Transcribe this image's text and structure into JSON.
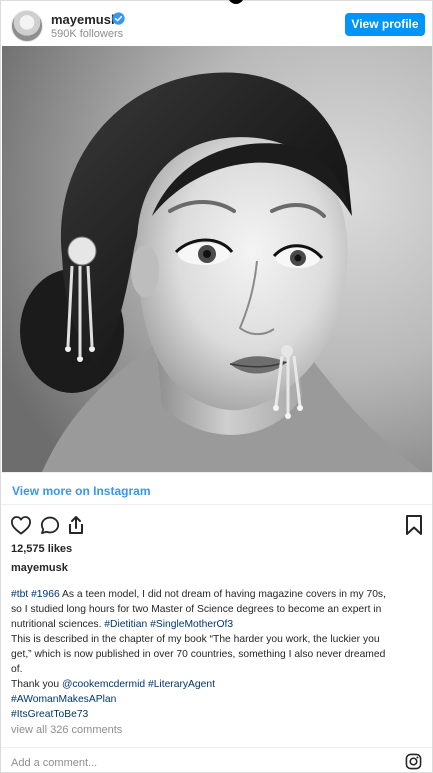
{
  "header": {
    "username": "mayemusk",
    "followers": "590K followers",
    "view_profile_label": "View profile"
  },
  "view_more_label": "View more on Instagram",
  "likes": "12,575 likes",
  "caption": {
    "username": "mayemusk",
    "lines": [
      {
        "parts": [
          {
            "t": "#tbt",
            "tag": true
          },
          {
            "t": " "
          },
          {
            "t": "#1966",
            "tag": true
          },
          {
            "t": " As a teen model, I did not dream of having magazine covers in my 70s,"
          }
        ]
      },
      {
        "parts": [
          {
            "t": "so I studied long hours for two Master of Science degrees to become an expert in"
          }
        ]
      },
      {
        "parts": [
          {
            "t": "nutritional sciences. "
          },
          {
            "t": "#Dietitian",
            "tag": true
          },
          {
            "t": " "
          },
          {
            "t": "#SingleMotherOf3",
            "tag": true
          }
        ]
      },
      {
        "parts": [
          {
            "t": "This is described in the chapter of my book “The harder you work, the luckier you"
          }
        ]
      },
      {
        "parts": [
          {
            "t": "get,” which is now published in over 70 countries, something I also never dreamed"
          }
        ]
      },
      {
        "parts": [
          {
            "t": "of."
          }
        ]
      },
      {
        "parts": [
          {
            "t": "Thank you "
          },
          {
            "t": "@cookemcdermid",
            "tag": true
          },
          {
            "t": " "
          },
          {
            "t": "#LiteraryAgent",
            "tag": true
          }
        ]
      },
      {
        "parts": [
          {
            "t": "#AWomanMakesAPlan",
            "tag": true
          }
        ]
      },
      {
        "parts": [
          {
            "t": "#ItsGreatToBe73",
            "tag": true
          }
        ]
      }
    ]
  },
  "comments_link": "view all 326 comments",
  "add_comment_placeholder": "Add a comment...",
  "icons": {
    "like": "heart-icon",
    "comment": "comment-icon",
    "share": "share-icon",
    "save": "bookmark-icon",
    "instagram": "instagram-icon",
    "verified": "verified-badge-icon"
  },
  "colors": {
    "accent": "#0095f6",
    "link": "#3897f0",
    "hashtag": "#00376b",
    "muted": "#8e8e8e"
  }
}
